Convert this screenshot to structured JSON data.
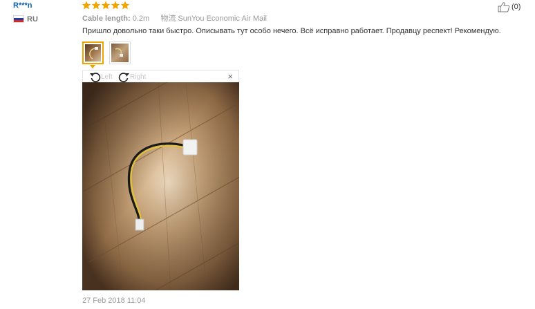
{
  "review": {
    "user": {
      "name": "R***n",
      "country": "RU",
      "flag_colors": [
        "#ffffff",
        "#1c3fa8",
        "#d52b1e"
      ]
    },
    "rating": {
      "stars": 5,
      "max": 5,
      "star_color": "#f0a400"
    },
    "info": {
      "label": "Cable length:",
      "value": "0.2m",
      "shipping_label": "物流",
      "shipping_value": "SunYou Economic Air Mail"
    },
    "helpful": {
      "count": "(0)"
    },
    "comment": "Пришло довольно таки быстро. Описывать тут особо нечего. Всё исправно работает. Продавцу респект! Рекомендую.",
    "date": "27 Feb 2018 11:04"
  },
  "viewer": {
    "rotate_left": "Left",
    "rotate_right": "Right",
    "close": "×"
  }
}
